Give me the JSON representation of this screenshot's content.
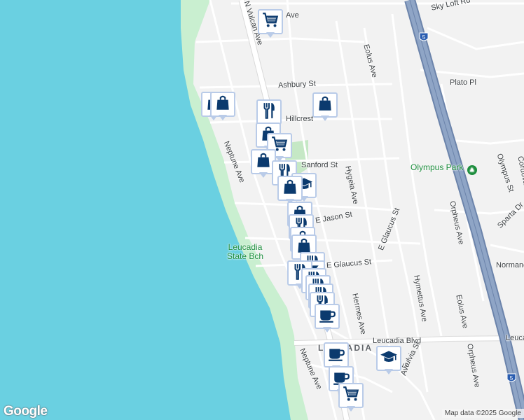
{
  "map": {
    "colors": {
      "water": "#6ad0e1",
      "land": "#f2f2f2",
      "beach": "#c9efd0",
      "park": "#c5e8c5",
      "road": "#ffffff",
      "road_outline": "#d9d9d9",
      "freeway": "#8fa5c6",
      "freeway_outline": "#6c84ab",
      "marker_icon": "#0b3a6e",
      "marker_border": "#b9cbe8",
      "park_label": "#1e8e3e"
    },
    "street_labels": [
      {
        "id": "vulcan",
        "text": "N Vulcan Ave"
      },
      {
        "id": "ave_top",
        "text": "Ave"
      },
      {
        "id": "skylo",
        "text": "Sky Loft Rd"
      },
      {
        "id": "eolus_n",
        "text": "Eolus Ave"
      },
      {
        "id": "ashbury",
        "text": "Ashbury St"
      },
      {
        "id": "plato",
        "text": "Plato Pl"
      },
      {
        "id": "hillcrest",
        "text": "Hillcrest"
      },
      {
        "id": "neptune_n",
        "text": "Neptune Ave"
      },
      {
        "id": "sanford",
        "text": "Sanford St"
      },
      {
        "id": "hygeia",
        "text": "Hygeia Ave"
      },
      {
        "id": "olympus_st",
        "text": "Olympus St"
      },
      {
        "id": "corda",
        "text": "Cordova St"
      },
      {
        "id": "orpheus_n",
        "text": "Orpheus Ave"
      },
      {
        "id": "ejason",
        "text": "E Jason St"
      },
      {
        "id": "eglaucus_s",
        "text": "E Glaucus St"
      },
      {
        "id": "sparta",
        "text": "Sparta Dr"
      },
      {
        "id": "eglaucus",
        "text": "E Glaucus St"
      },
      {
        "id": "normandy",
        "text": "Normand"
      },
      {
        "id": "hymettus",
        "text": "Hymettus Ave"
      },
      {
        "id": "hermes",
        "text": "Hermes Ave"
      },
      {
        "id": "eolus_s",
        "text": "Eolus Ave"
      },
      {
        "id": "leucadia_blvd",
        "text": "Leucadia Blvd"
      },
      {
        "id": "leucadia_e",
        "text": "Leuca"
      },
      {
        "id": "fulvia",
        "text": "Fulvia St"
      },
      {
        "id": "orpheus_s",
        "text": "Orpheus Ave"
      },
      {
        "id": "neptune_s",
        "text": "Neptune Ave"
      },
      {
        "id": "vulcan_s",
        "text": "Ave"
      }
    ],
    "park_labels": {
      "olympus_park": "Olympus Park",
      "leucadia_state_beach_1": "Leucadia",
      "leucadia_state_beach_2": "State Bch"
    },
    "area_label": "LEUCADIA",
    "highway_shield": "5",
    "markers": [
      {
        "icon": "cart"
      },
      {
        "icon": "shopping-bag"
      },
      {
        "icon": "shopping-bag"
      },
      {
        "icon": "shopping-bag"
      },
      {
        "icon": "restaurant"
      },
      {
        "icon": "shopping-bag"
      },
      {
        "icon": "cart"
      },
      {
        "icon": "shopping-bag"
      },
      {
        "icon": "restaurant"
      },
      {
        "icon": "school"
      },
      {
        "icon": "shopping-bag"
      },
      {
        "icon": "shopping-bag"
      },
      {
        "icon": "restaurant"
      },
      {
        "icon": "shopping-bag"
      },
      {
        "icon": "shopping-bag"
      },
      {
        "icon": "restaurant"
      },
      {
        "icon": "bar"
      },
      {
        "icon": "restaurant"
      },
      {
        "icon": "restaurant"
      },
      {
        "icon": "restaurant"
      },
      {
        "icon": "restaurant"
      },
      {
        "icon": "restaurant"
      },
      {
        "icon": "coffee"
      },
      {
        "icon": "coffee"
      },
      {
        "icon": "school"
      },
      {
        "icon": "coffee"
      },
      {
        "icon": "cart"
      }
    ],
    "google_logo": "Google",
    "attribution": "Map data ©2025 Google"
  }
}
